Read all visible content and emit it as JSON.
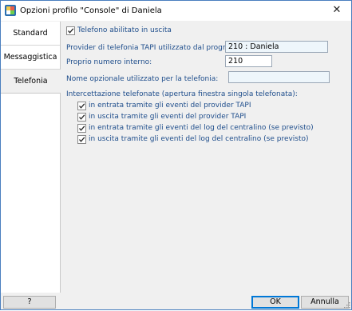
{
  "window": {
    "title": "Opzioni profilo \"Console\" di Daniela",
    "close_symbol": "✕",
    "app_icon": "app-logo-icon"
  },
  "tabs": [
    {
      "label": "Standard",
      "active": false
    },
    {
      "label": "Messaggistica",
      "active": false
    },
    {
      "label": "Telefonia",
      "active": true
    }
  ],
  "telefonia": {
    "phone_enabled": {
      "label": "Telefono abilitato in uscita",
      "checked": true
    },
    "tapi_provider": {
      "label": "Provider di telefonia TAPI utilizzato dal programma:",
      "value": "210 : Daniela"
    },
    "internal_number": {
      "label": "Proprio numero interno:",
      "value": "210"
    },
    "optional_name": {
      "label": "Nome opzionale utilizzato per la telefonia:",
      "value": ""
    },
    "interception": {
      "heading": "Intercettazione telefonate (apertura finestra singola telefonata):",
      "options": [
        {
          "label": "in entrata tramite gli eventi del provider TAPI",
          "checked": true
        },
        {
          "label": "in uscita tramite gli eventi del provider TAPI",
          "checked": true
        },
        {
          "label": "in entrata tramite gli eventi del log del centralino (se previsto)",
          "checked": true
        },
        {
          "label": "in uscita tramite gli eventi del log del centralino (se previsto)",
          "checked": true
        }
      ]
    }
  },
  "buttons": {
    "help": "?",
    "ok": "OK",
    "cancel": "Annulla"
  },
  "colors": {
    "accent_border": "#4a7fbf",
    "label_blue": "#1f4e8c",
    "field_bg": "#eef6fb"
  }
}
